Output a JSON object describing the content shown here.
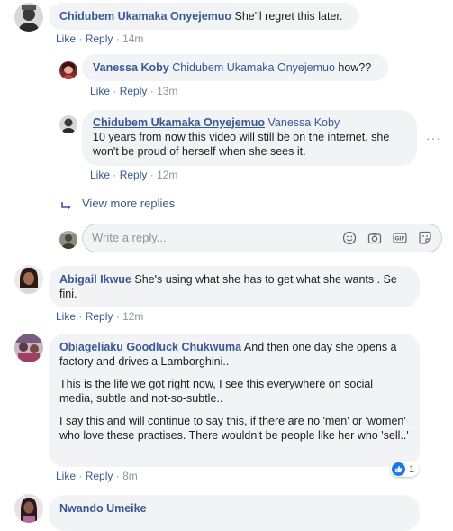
{
  "comments": [
    {
      "author": "Chidubem Ukamaka Onyejemuo",
      "text": "She'll regret this later.",
      "actions": {
        "like": "Like",
        "reply": "Reply",
        "time": "14m"
      },
      "replies": [
        {
          "author": "Vanessa Koby",
          "mention": "Chidubem Ukamaka Onyejemuo",
          "text": "how??",
          "actions": {
            "like": "Like",
            "reply": "Reply",
            "time": "13m"
          }
        },
        {
          "author": "Chidubem Ukamaka Onyejemuo",
          "mention": "Vanessa Koby",
          "text": "10 years from now this video will still be on the internet, she won't be proud of herself when she sees it.",
          "actions": {
            "like": "Like",
            "reply": "Reply",
            "time": "12m"
          }
        }
      ],
      "view_more_label": "View more replies",
      "reply_placeholder": "Write a reply...",
      "gif_label": "GIF"
    },
    {
      "author": "Abigail Ikwue",
      "text": "She's using what she has to get what she wants . Se fini.",
      "actions": {
        "like": "Like",
        "reply": "Reply",
        "time": "12m"
      }
    },
    {
      "author": "Obiageliaku Goodluck Chukwuma",
      "paragraphs": [
        "And then one day she opens a factory and drives a Lamborghini..",
        "This is the life we got right now, I see this everywhere on social media, subtle and not-so-subtle..",
        "I say this and will continue to say this, if there are no 'men' or 'women' who love these practises. There wouldn't be people like her who 'sell..'"
      ],
      "actions": {
        "like": "Like",
        "reply": "Reply",
        "time": "8m"
      },
      "reaction_count": "1"
    },
    {
      "author": "Nwando Umeike"
    }
  ],
  "dot": "·",
  "more": "···",
  "colors": {
    "link": "#385898",
    "bubble": "#f2f3f5",
    "meta": "#90949c",
    "like_blue": "#1877f2"
  },
  "icons": [
    "emoji-icon",
    "camera-icon",
    "gif-icon",
    "sticker-icon",
    "thumbs-up-icon",
    "reply-arrow-icon"
  ]
}
